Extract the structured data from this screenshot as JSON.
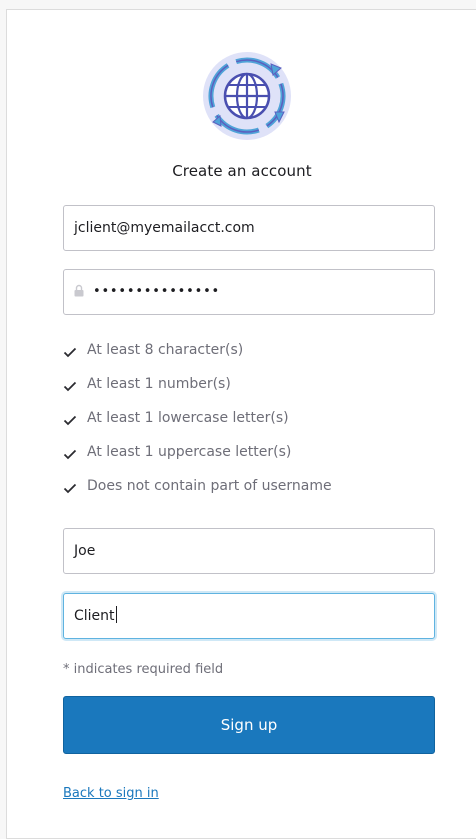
{
  "title": "Create an account",
  "logo_icon": "globe-with-arrows-icon",
  "fields": {
    "email": "jclient@myemailacct.com",
    "password_masked": "•••••••••••••••",
    "first_name": "Joe",
    "last_name": "Client"
  },
  "password_rules": [
    {
      "label": "At least 8 character(s)",
      "met": true
    },
    {
      "label": "At least 1 number(s)",
      "met": true
    },
    {
      "label": "At least 1 lowercase letter(s)",
      "met": true
    },
    {
      "label": "At least 1 uppercase letter(s)",
      "met": true
    },
    {
      "label": "Does not contain part of username",
      "met": true
    }
  ],
  "required_note": "* indicates required field",
  "signup_label": "Sign up",
  "back_link": "Back to sign in",
  "colors": {
    "primary": "#1a78bd",
    "focus_ring": "#5fb3e0",
    "muted_text": "#6e6e78"
  }
}
